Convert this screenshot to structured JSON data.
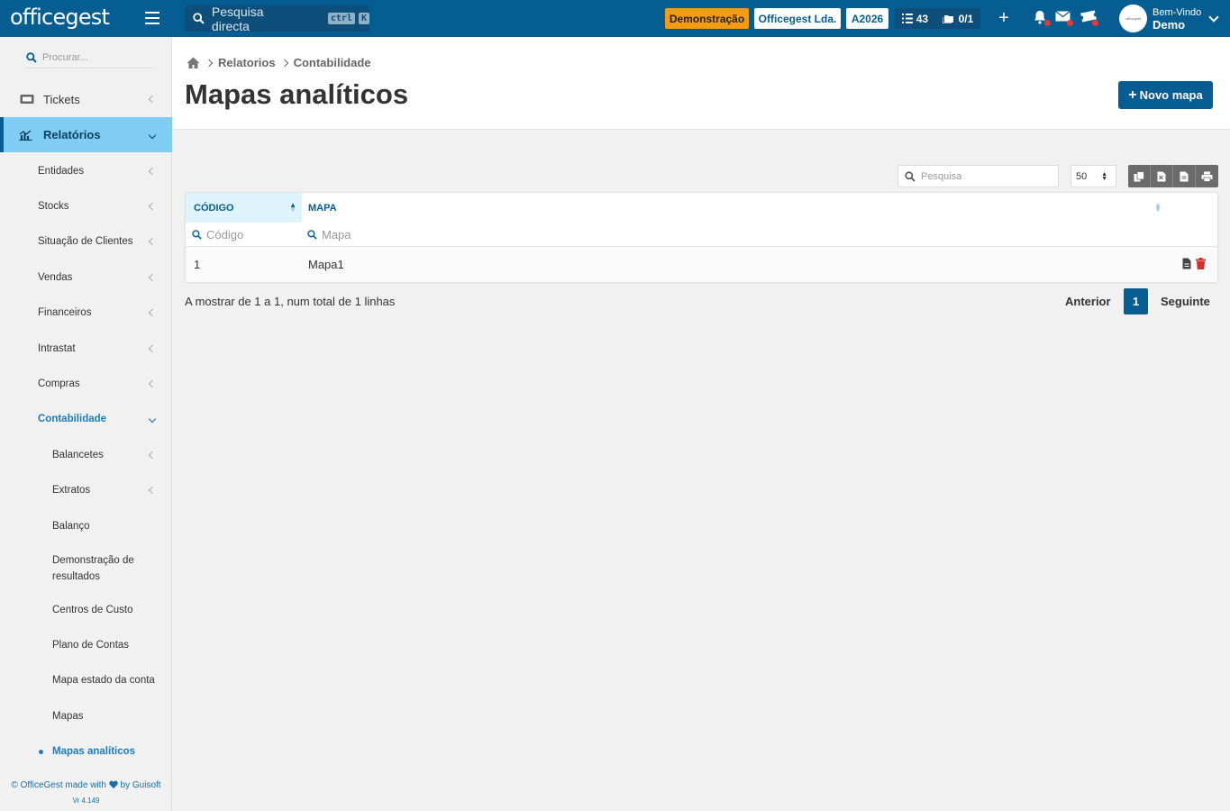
{
  "topbar": {
    "logo": "officegest",
    "search_placeholder": "Pesquisa directa",
    "kbd_ctrl": "ctrl",
    "kbd_k": "K",
    "demo_badge": "Demonstração",
    "company": "Officegest Lda.",
    "year": "A2026",
    "tasks_count": "43",
    "docs_count": "0/1",
    "plus": "+",
    "welcome": "Bem-Vindo",
    "username": "Demo",
    "avatar_text": "officegest"
  },
  "sidebar": {
    "search_placeholder": "Procurar...",
    "items": [
      {
        "label": "Tickets"
      },
      {
        "label": "Relatórios"
      },
      {
        "label": "Entidades"
      },
      {
        "label": "Stocks"
      },
      {
        "label": "Situação de Clientes"
      },
      {
        "label": "Vendas"
      },
      {
        "label": "Financeiros"
      },
      {
        "label": "Intrastat"
      },
      {
        "label": "Compras"
      },
      {
        "label": "Contabilidade"
      },
      {
        "label": "Balancetes"
      },
      {
        "label": "Extratos"
      },
      {
        "label": "Balanço"
      },
      {
        "label": "Demonstração de resultados"
      },
      {
        "label": "Centros de Custo"
      },
      {
        "label": "Plano de Contas"
      },
      {
        "label": "Mapa estado da conta"
      },
      {
        "label": "Mapas"
      },
      {
        "label": "Mapas analíticos"
      }
    ],
    "footer_left": "© OfficeGest made with",
    "footer_right": "by Guisoft",
    "version": "Vr 4.149"
  },
  "breadcrumb": {
    "level1": "Relatorios",
    "level2": "Contabilidade"
  },
  "page": {
    "title": "Mapas analíticos",
    "new_button": "Novo mapa"
  },
  "table": {
    "search_placeholder": "Pesquisa",
    "page_size": "50",
    "columns": [
      "CÓDIGO",
      "MAPA"
    ],
    "filter_placeholders": [
      "Código",
      "Mapa"
    ],
    "rows": [
      {
        "codigo": "1",
        "mapa": "Mapa1"
      }
    ],
    "info": "A mostrar de 1 a 1, num total de 1 linhas",
    "prev": "Anterior",
    "current_page": "1",
    "next": "Seguinte"
  }
}
